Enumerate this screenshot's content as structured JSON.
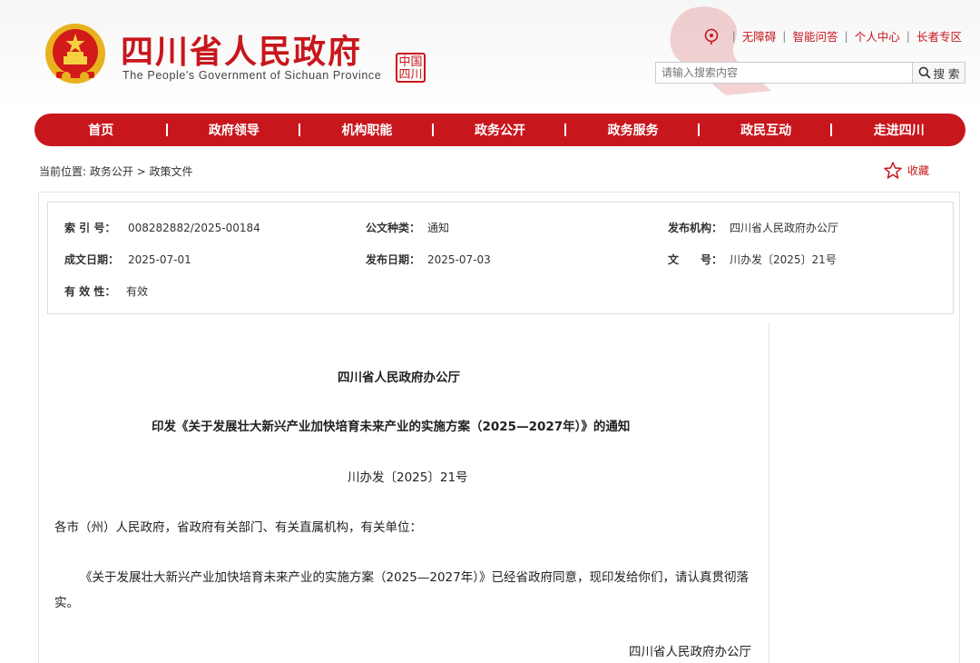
{
  "header": {
    "title": "四川省人民政府",
    "subtitle": "The People's Government of Sichuan Province",
    "seal_text": "中国 四川",
    "links": [
      "无障碍",
      "智能问答",
      "个人中心",
      "长者专区"
    ],
    "search_placeholder": "请输入搜索内容",
    "search_button": "搜 索"
  },
  "nav": {
    "items": [
      "首页",
      "政府领导",
      "机构职能",
      "政务公开",
      "政务服务",
      "政民互动",
      "走进四川"
    ]
  },
  "breadcrumb": "当前位置:  政务公开 > 政策文件",
  "favorite": {
    "label": "收藏"
  },
  "meta": {
    "index_label": "索 引 号：",
    "index_value": "008282882/2025-00184",
    "type_label": "公文种类：",
    "type_value": "通知",
    "issuer_label": "发布机构：",
    "issuer_value": "四川省人民政府办公厅",
    "written_label": "成文日期：",
    "written_value": "2025-07-01",
    "published_label": "发布日期：",
    "published_value": "2025-07-03",
    "docno_label": "文　　号：",
    "docno_value": "川办发〔2025〕21号",
    "validity_label": "有 效 性：",
    "validity_value": "有效"
  },
  "document": {
    "issuer": "四川省人民政府办公厅",
    "title": "印发《关于发展壮大新兴产业加快培育未来产业的实施方案（2025—2027年）》的通知",
    "doc_number": "川办发〔2025〕21号",
    "salutation": "各市（州）人民政府，省政府有关部门、有关直属机构，有关单位：",
    "body_line1": "《关于发展壮大新兴产业加快培育未来产业的实施方案（2025—2027年）》已经省政府同意，现印发给你们，请认真贯彻落",
    "body_line2": "实。",
    "signature": "四川省人民政府办公厅"
  },
  "colors": {
    "brand_red": "#c8161d"
  },
  "icons": [
    "national-emblem-icon",
    "location-icon",
    "search-icon",
    "star-icon"
  ]
}
